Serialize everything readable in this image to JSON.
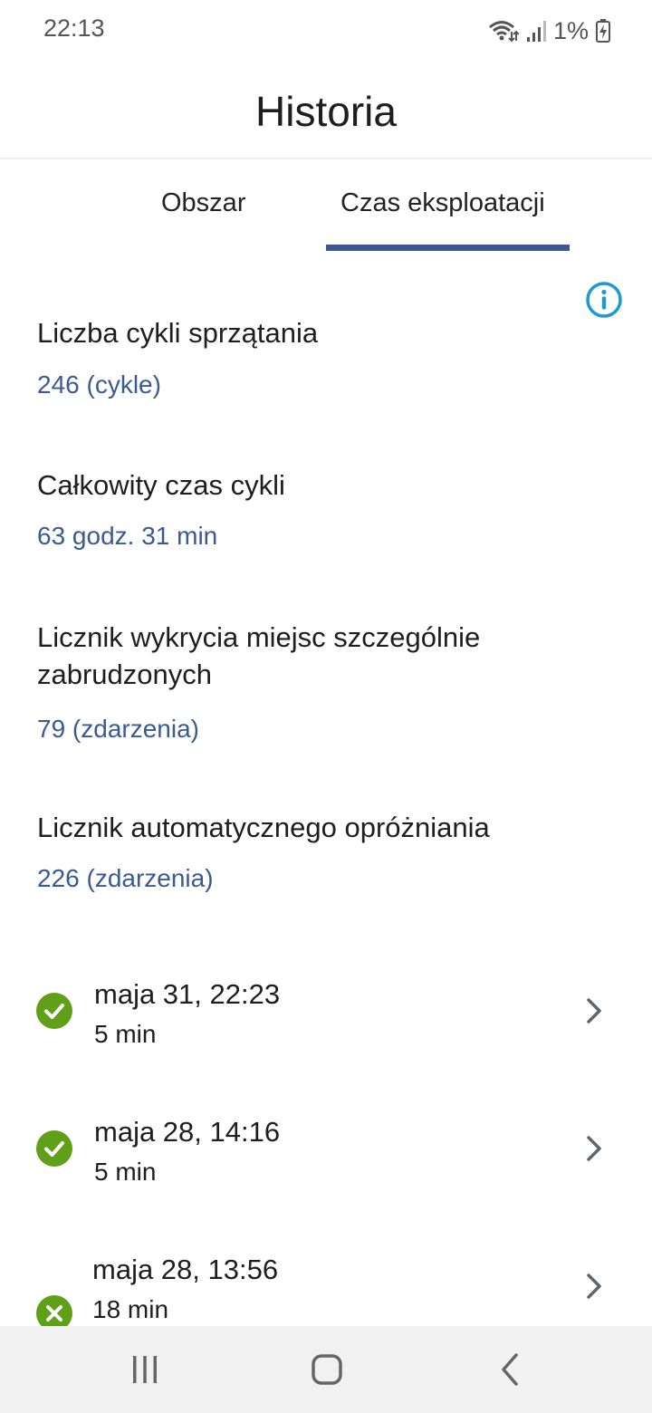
{
  "status_bar": {
    "time": "22:13",
    "battery": "1%",
    "icons": [
      "wifi-icon",
      "signal-icon",
      "battery-charging-icon"
    ]
  },
  "header": {
    "title": "Historia"
  },
  "tabs": [
    {
      "label": "Obszar",
      "selected": false
    },
    {
      "label": "Czas eksploatacji",
      "selected": true
    }
  ],
  "colors": {
    "accent": "#3b5a93",
    "info": "#1a9bd1",
    "success": "#5fa018",
    "nav_bg": "#f1f1f1"
  },
  "stats": [
    {
      "title": "Liczba cykli sprzątania",
      "value": "246 (cykle)"
    },
    {
      "title": "Całkowity czas cykli",
      "value": "63 godz. 31 min"
    },
    {
      "title": "Licznik wykrycia miejsc szczególnie zabrudzonych",
      "value": "79 (zdarzenia)"
    },
    {
      "title": "Licznik automatycznego opróżniania",
      "value": "226 (zdarzenia)"
    }
  ],
  "history": [
    {
      "date": "maja 31, 22:23",
      "duration": "5 min",
      "status": "completed",
      "icon": "check-circle-icon"
    },
    {
      "date": "maja 28, 14:16",
      "duration": "5 min",
      "status": "completed",
      "icon": "check-circle-icon"
    },
    {
      "date": "maja 28, 13:56",
      "duration": "18 min",
      "status": "failed",
      "icon": "x-circle-icon"
    }
  ],
  "nav": [
    "recent-apps-icon",
    "home-icon",
    "back-icon"
  ]
}
